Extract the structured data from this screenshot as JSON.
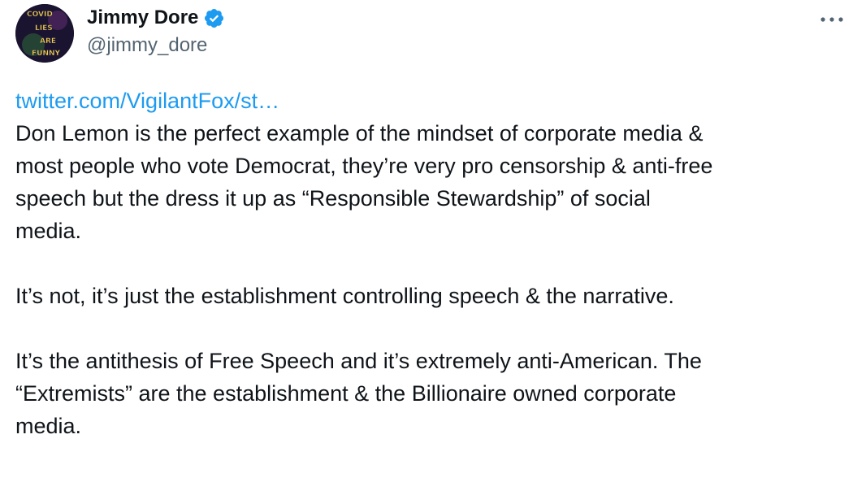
{
  "author": {
    "display_name": "Jimmy Dore",
    "handle": "@jimmy_dore",
    "verified": true,
    "avatar_text": [
      "COVID",
      "LIES",
      "ARE",
      "FUNNY"
    ]
  },
  "tweet": {
    "link_text": "twitter.com/VigilantFox/st…",
    "paragraphs": [
      [
        "Don Lemon is the perfect example of the mindset of corporate media &",
        "most people who vote Democrat, they’re very pro censorship & anti-free",
        "speech but the dress it up as “Responsible Stewardship” of social",
        "media."
      ],
      [
        "It’s not, it’s just the establishment controlling speech & the narrative."
      ],
      [
        "It’s the antithesis of Free Speech and it’s extremely anti-American. The",
        "“Extremists” are the establishment & the Billionaire owned corporate",
        "media."
      ]
    ]
  },
  "icons": {
    "verified": "verified-badge-icon",
    "more": "more-options-icon"
  },
  "colors": {
    "link": "#1d9bf0",
    "text": "#0f1419",
    "secondary": "#536471",
    "verified": "#1d9bf0"
  }
}
